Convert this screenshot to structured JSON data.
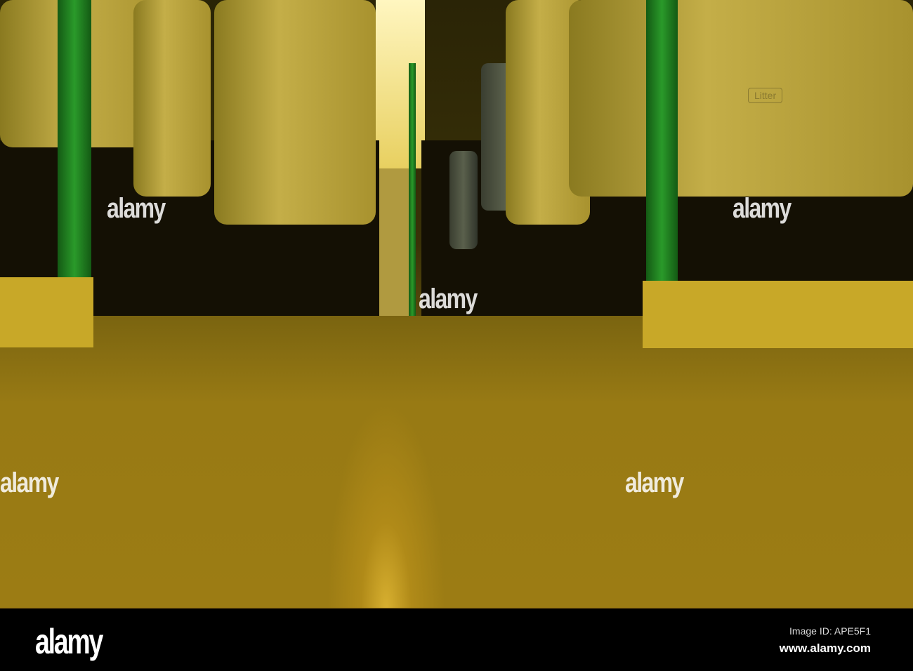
{
  "photo": {
    "sign_text": "Litter",
    "watermark": "alamy"
  },
  "footer": {
    "logo": "alamy",
    "image_id": "Image ID: APE5F1",
    "website": "www.alamy.com"
  }
}
